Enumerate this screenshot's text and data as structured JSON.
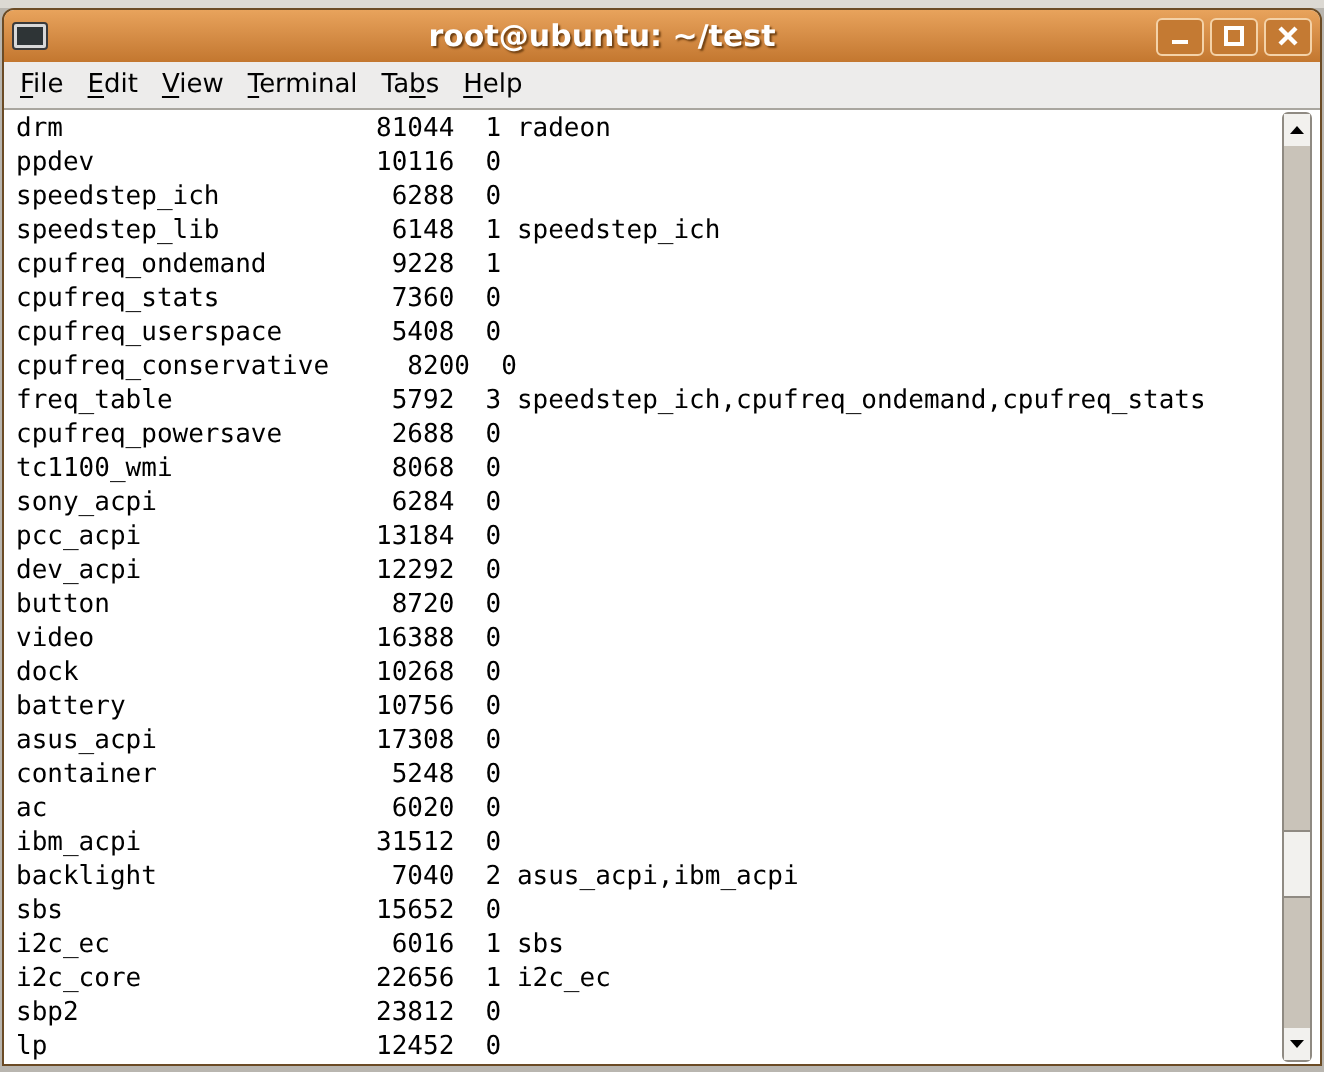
{
  "window": {
    "title": "root@ubuntu: ~/test"
  },
  "menu": [
    {
      "key": "F",
      "after": "ile"
    },
    {
      "key": "E",
      "after": "dit"
    },
    {
      "key": "V",
      "after": "iew"
    },
    {
      "key": "T",
      "after": "erminal"
    },
    {
      "before": "Ta",
      "key": "b",
      "after": "s"
    },
    {
      "key": "H",
      "after": "elp"
    }
  ],
  "terminal": {
    "lines": [
      "drm                    81044  1 radeon",
      "ppdev                  10116  0",
      "speedstep_ich           6288  0",
      "speedstep_lib           6148  1 speedstep_ich",
      "cpufreq_ondemand        9228  1",
      "cpufreq_stats           7360  0",
      "cpufreq_userspace       5408  0",
      "cpufreq_conservative     8200  0",
      "freq_table              5792  3 speedstep_ich,cpufreq_ondemand,cpufreq_stats",
      "cpufreq_powersave       2688  0",
      "tc1100_wmi              8068  0",
      "sony_acpi               6284  0",
      "pcc_acpi               13184  0",
      "dev_acpi               12292  0",
      "button                  8720  0",
      "video                  16388  0",
      "dock                   10268  0",
      "battery                10756  0",
      "asus_acpi              17308  0",
      "container               5248  0",
      "ac                      6020  0",
      "ibm_acpi               31512  0",
      "backlight               7040  2 asus_acpi,ibm_acpi",
      "sbs                    15652  0",
      "i2c_ec                  6016  1 sbs",
      "i2c_core               22656  1 i2c_ec",
      "sbp2                   23812  0",
      "lp                     12452  0"
    ]
  }
}
